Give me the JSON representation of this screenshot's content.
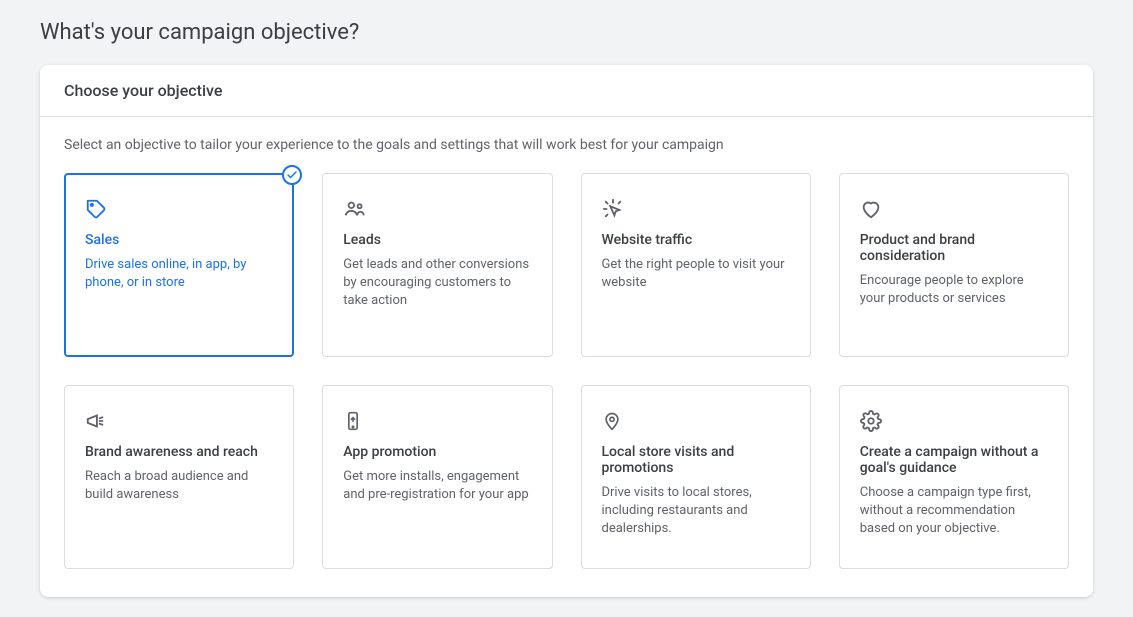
{
  "page_title": "What's your campaign objective?",
  "panel_title": "Choose your objective",
  "subtext": "Select an objective to tailor your experience to the goals and settings that will work best for your campaign",
  "cards": [
    {
      "id": "sales",
      "title": "Sales",
      "desc": "Drive sales online, in app, by phone, or in store",
      "selected": true
    },
    {
      "id": "leads",
      "title": "Leads",
      "desc": "Get leads and other conversions by encouraging customers to take action",
      "selected": false
    },
    {
      "id": "website-traffic",
      "title": "Website traffic",
      "desc": "Get the right people to visit your website",
      "selected": false
    },
    {
      "id": "product-brand-consideration",
      "title": "Product and brand consideration",
      "desc": "Encourage people to explore your products or services",
      "selected": false
    },
    {
      "id": "brand-awareness-reach",
      "title": "Brand awareness and reach",
      "desc": "Reach a broad audience and build awareness",
      "selected": false
    },
    {
      "id": "app-promotion",
      "title": "App promotion",
      "desc": "Get more installs, engagement and pre-registration for your app",
      "selected": false
    },
    {
      "id": "local-store-visits",
      "title": "Local store visits and promotions",
      "desc": "Drive visits to local stores, including restaurants and dealerships.",
      "selected": false
    },
    {
      "id": "no-goal",
      "title": "Create a campaign without a goal's guidance",
      "desc": "Choose a campaign type first, without a recommendation based on your objective.",
      "selected": false
    }
  ]
}
